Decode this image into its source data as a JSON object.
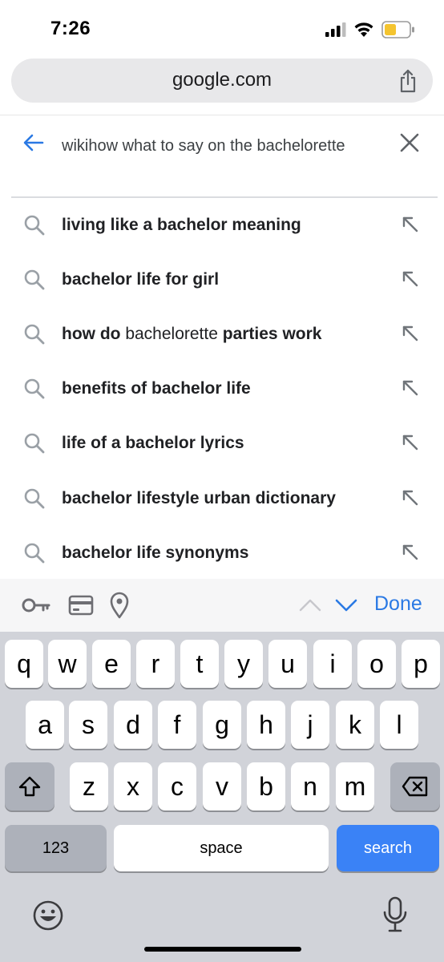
{
  "status_bar": {
    "time": "7:26"
  },
  "browser": {
    "url": "google.com"
  },
  "search": {
    "query": "wikihow what to say on the bachelorette"
  },
  "suggestions": [
    {
      "bold_pre": "living like a bachelor meaning",
      "plain": "",
      "bold_post": ""
    },
    {
      "bold_pre": "bachelor life for girl",
      "plain": "",
      "bold_post": ""
    },
    {
      "bold_pre": "how do",
      "plain": " bachelorette ",
      "bold_post": "parties work"
    },
    {
      "bold_pre": "benefits of bachelor life",
      "plain": "",
      "bold_post": ""
    },
    {
      "bold_pre": "life of a bachelor lyrics",
      "plain": "",
      "bold_post": ""
    },
    {
      "bold_pre": "bachelor lifestyle urban dictionary",
      "plain": "",
      "bold_post": ""
    },
    {
      "bold_pre": "bachelor life synonyms",
      "plain": "",
      "bold_post": ""
    }
  ],
  "accessory": {
    "icons": [
      "key-icon",
      "credit-card-icon",
      "location-pin-icon",
      "chevron-up-icon",
      "chevron-down-icon"
    ],
    "done_label": "Done"
  },
  "keyboard": {
    "row1": [
      "q",
      "w",
      "e",
      "r",
      "t",
      "y",
      "u",
      "i",
      "o",
      "p"
    ],
    "row2": [
      "a",
      "s",
      "d",
      "f",
      "g",
      "h",
      "j",
      "k",
      "l"
    ],
    "row3": [
      "z",
      "x",
      "c",
      "v",
      "b",
      "n",
      "m"
    ],
    "numbers_label": "123",
    "space_label": "space",
    "search_label": "search",
    "icons": [
      "shift-icon",
      "backspace-icon",
      "emoji-icon",
      "microphone-icon"
    ]
  },
  "colors": {
    "accent_blue": "#2a79e4",
    "search_key_blue": "#3a82f6",
    "battery_yellow": "#f4c430",
    "keyboard_bg": "#d1d3d9"
  }
}
